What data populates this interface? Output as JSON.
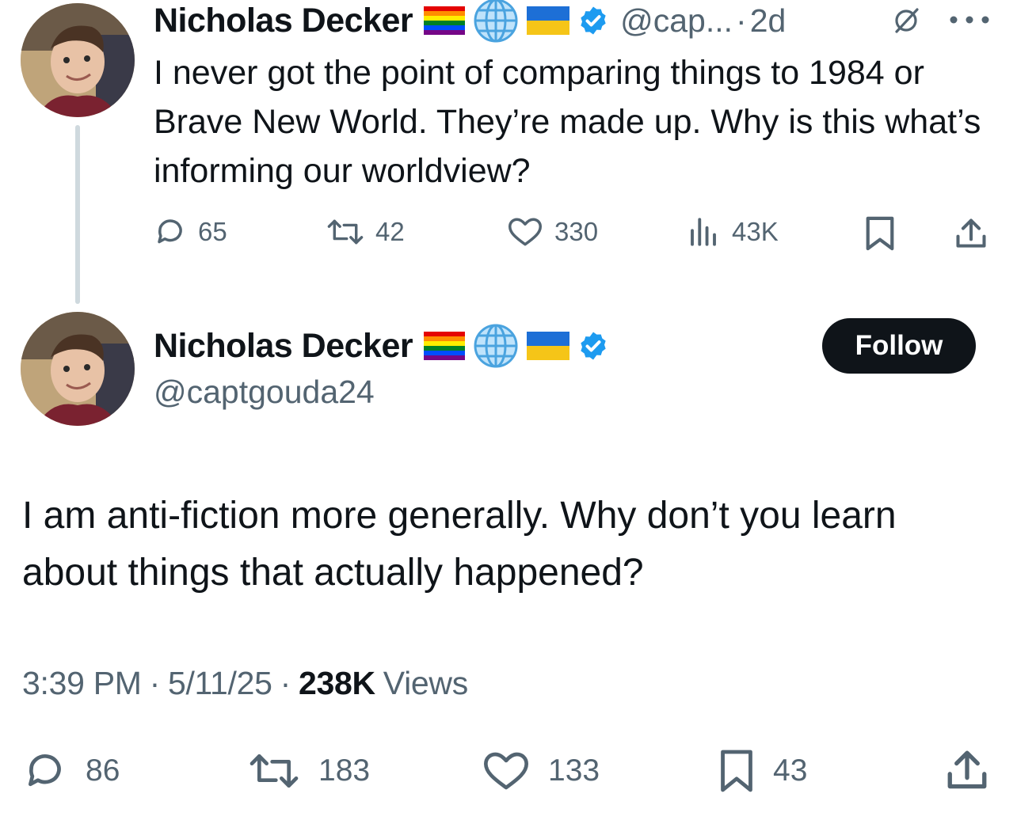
{
  "parent_tweet": {
    "author_name": "Nicholas Decker",
    "handle_truncated": "@cap...",
    "separator": "·",
    "age": "2d",
    "text": "I never got the point of comparing things to 1984 or Brave New World. They’re made up. Why is this what’s informing our worldview?",
    "actions": {
      "replies": "65",
      "reposts": "42",
      "likes": "330",
      "views": "43K"
    }
  },
  "main_tweet": {
    "author_name": "Nicholas Decker",
    "handle": "@captgouda24",
    "follow_label": "Follow",
    "text": "I am anti-fiction more generally. Why don’t you learn about things that actually happened?",
    "meta": {
      "time": "3:39 PM",
      "sep1": "·",
      "date": "5/11/25",
      "sep2": "·",
      "views_count": "238K",
      "views_label": "Views"
    },
    "actions": {
      "replies": "86",
      "reposts": "183",
      "likes": "133",
      "bookmarks": "43"
    }
  },
  "icons": {
    "badges": [
      "rainbow-flag-icon",
      "globe-icon",
      "ukraine-flag-icon",
      "verified-badge-icon"
    ],
    "top_right": [
      "grok-icon",
      "more-icon"
    ],
    "actions": [
      "reply-icon",
      "repost-icon",
      "like-icon",
      "views-icon",
      "bookmark-icon",
      "share-icon"
    ]
  },
  "colors": {
    "text": "#0f1419",
    "muted": "#536471",
    "verified": "#1d9bf0",
    "thread_line": "#cfd9de",
    "follow_bg": "#0f1419"
  }
}
